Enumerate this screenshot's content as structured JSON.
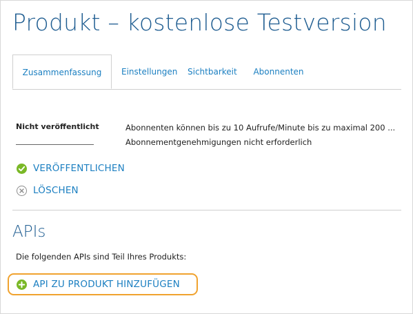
{
  "page": {
    "title": "Produkt – kostenlose Testversion"
  },
  "tabs": [
    {
      "label": "Zusammenfassung",
      "active": true
    },
    {
      "label": "Einstellungen",
      "active": false
    },
    {
      "label": "Sichtbarkeit",
      "active": false
    },
    {
      "label": "Abonnenten",
      "active": false
    }
  ],
  "summary": {
    "status_label": "Nicht veröffentlicht",
    "description_lines": [
      "Abonnenten können bis zu 10 Aufrufe/Minute bis zu maximal 200 ...",
      "Abonnementgenehmigungen nicht erforderlich"
    ]
  },
  "actions": {
    "publish_label": "VERÖFFENTLICHEN",
    "delete_label": "LÖSCHEN"
  },
  "apis_section": {
    "heading": "APIs",
    "description": "Die folgenden APIs sind Teil Ihres Produkts:",
    "add_label": "API ZU PRODUKT HINZUFÜGEN"
  },
  "icons": {
    "publish": "check-circle-icon",
    "delete": "x-circle-icon",
    "add": "plus-circle-icon"
  },
  "colors": {
    "title": "#1f5d91",
    "link": "#1b7fc1",
    "success_green": "#7ab827",
    "highlight_orange": "#f0a22e"
  }
}
